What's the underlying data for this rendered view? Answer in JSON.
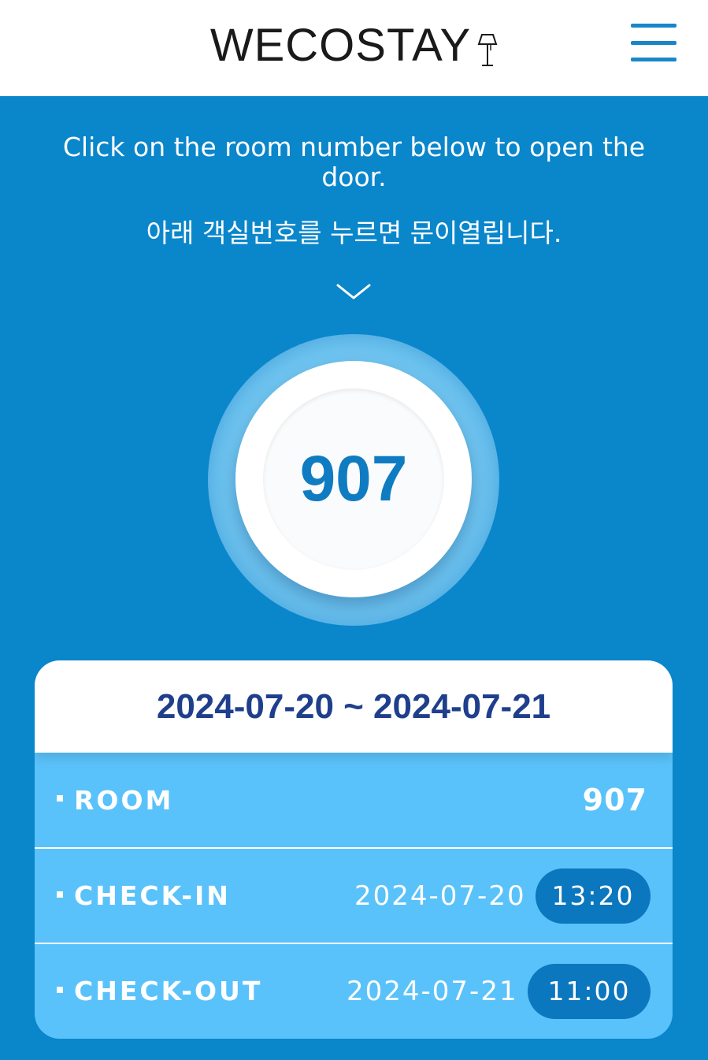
{
  "header": {
    "logo_text": "WECOSTAY",
    "logo_icon": "lamp-icon",
    "menu_icon": "hamburger-menu-icon"
  },
  "instructions": {
    "en": "Click on the room number below to open the door.",
    "ko": "아래 객실번호를 누르면 문이열립니다."
  },
  "room_button": {
    "number": "907"
  },
  "booking": {
    "date_range": "2024-07-20 ~ 2024-07-21",
    "room_label": "ROOM",
    "room_value": "907",
    "checkin_label": "CHECK-IN",
    "checkin_date": "2024-07-20",
    "checkin_time": "13:20",
    "checkout_label": "CHECK-OUT",
    "checkout_date": "2024-07-21",
    "checkout_time": "11:00"
  },
  "colors": {
    "background": "#0a86cb",
    "card_rows": "#5ac2fa",
    "accent_text": "#1f3f8c",
    "room_number": "#0f7cc2",
    "time_pill": "#0b77be"
  }
}
